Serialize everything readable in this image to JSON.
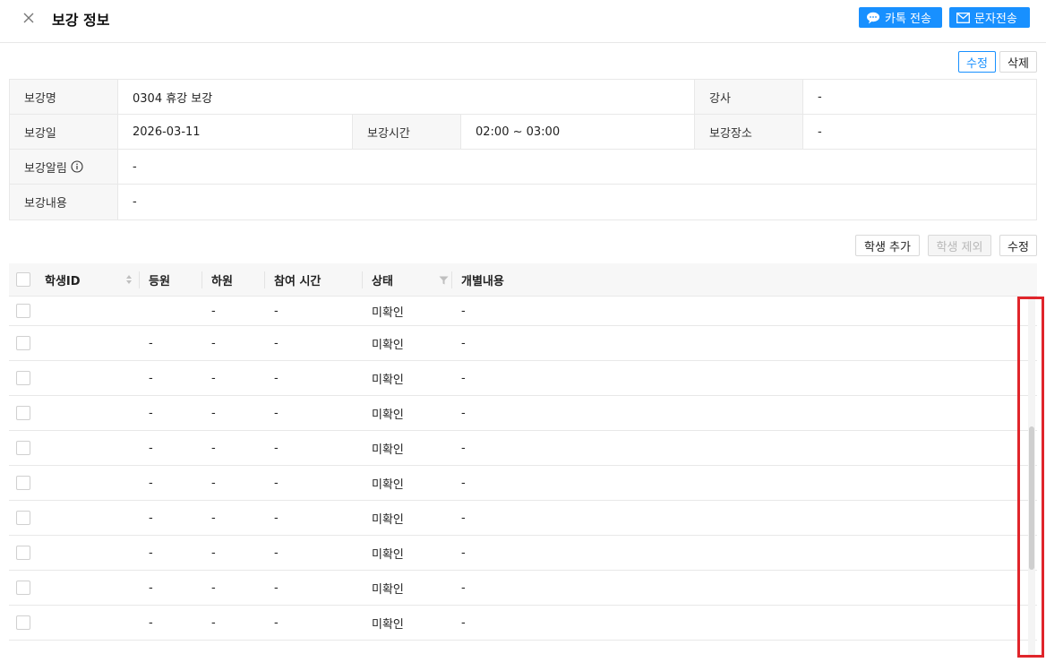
{
  "header": {
    "title": "보강 정보",
    "kakao_label": "카톡 전송",
    "sms_label": "문자전송"
  },
  "actions": {
    "edit_label": "수정",
    "delete_label": "삭제"
  },
  "info": {
    "name_label": "보강명",
    "name_value": "0304 휴강 보강",
    "teacher_label": "강사",
    "teacher_value": "-",
    "date_label": "보강일",
    "date_value": "2026-03-11",
    "time_label": "보강시간",
    "time_value": "02:00 ~ 03:00",
    "place_label": "보강장소",
    "place_value": "-",
    "alarm_label": "보강알림",
    "alarm_value": "-",
    "content_label": "보강내용",
    "content_value": "-"
  },
  "student_actions": {
    "add_label": "학생 추가",
    "remove_label": "학생 제외",
    "edit_label": "수정"
  },
  "table": {
    "headers": {
      "id": "학생ID",
      "enroll": "등원",
      "leave": "하원",
      "time": "참여 시간",
      "status": "상태",
      "memo": "개별내용"
    },
    "rows": [
      {
        "id": "",
        "enroll": "",
        "leave": "-",
        "time": "-",
        "status": "미확인",
        "memo": "-"
      },
      {
        "id": "",
        "enroll": "-",
        "leave": "-",
        "time": "-",
        "status": "미확인",
        "memo": "-"
      },
      {
        "id": "",
        "enroll": "-",
        "leave": "-",
        "time": "-",
        "status": "미확인",
        "memo": "-"
      },
      {
        "id": "",
        "enroll": "-",
        "leave": "-",
        "time": "-",
        "status": "미확인",
        "memo": "-"
      },
      {
        "id": "",
        "enroll": "-",
        "leave": "-",
        "time": "-",
        "status": "미확인",
        "memo": "-"
      },
      {
        "id": "",
        "enroll": "-",
        "leave": "-",
        "time": "-",
        "status": "미확인",
        "memo": "-"
      },
      {
        "id": "",
        "enroll": "-",
        "leave": "-",
        "time": "-",
        "status": "미확인",
        "memo": "-"
      },
      {
        "id": "",
        "enroll": "-",
        "leave": "-",
        "time": "-",
        "status": "미확인",
        "memo": "-"
      },
      {
        "id": "",
        "enroll": "-",
        "leave": "-",
        "time": "-",
        "status": "미확인",
        "memo": "-"
      },
      {
        "id": "",
        "enroll": "-",
        "leave": "-",
        "time": "-",
        "status": "미확인",
        "memo": "-"
      }
    ]
  },
  "scrollbar": {
    "position_fraction": 0.6,
    "visible_fraction": 0.4
  },
  "colors": {
    "primary": "#1890ff",
    "highlight": "#e0252b"
  }
}
